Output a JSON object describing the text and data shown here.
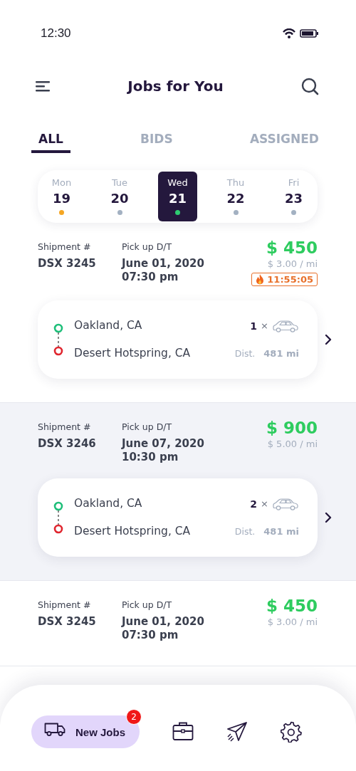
{
  "status_bar": {
    "time": "12:30"
  },
  "header": {
    "title": "Jobs for You"
  },
  "tabs": [
    {
      "label": "ALL",
      "selected": true
    },
    {
      "label": "BIDS",
      "selected": false
    },
    {
      "label": "ASSIGNED",
      "selected": false
    }
  ],
  "dates": [
    {
      "day": "Mon",
      "date": "19",
      "color": "#f5a623",
      "selected": false
    },
    {
      "day": "Tue",
      "date": "20",
      "color": "#a3b1c2",
      "selected": false
    },
    {
      "day": "Wed",
      "date": "21",
      "color": "#2ecc71",
      "selected": true
    },
    {
      "day": "Thu",
      "date": "22",
      "color": "#a3b1c2",
      "selected": false
    },
    {
      "day": "Fri",
      "date": "23",
      "color": "#a3b1c2",
      "selected": false
    }
  ],
  "jobs": [
    {
      "selected": false,
      "shipment_label": "Shipment #",
      "shipment_no": "DSX 3245",
      "pickup_label": "Pick up D/T",
      "pickup_date": "June 01, 2020",
      "pickup_time": "07:30 pm",
      "price": "$ 450",
      "rate": "$ 3.00 / mi",
      "timer": "11:55:05",
      "origin": "Oakland, CA",
      "destination": "Desert Hotspring, CA",
      "vehicle_count": "1",
      "times": "×",
      "dist_label": "Dist.",
      "distance": "481 mi"
    },
    {
      "selected": true,
      "shipment_label": "Shipment #",
      "shipment_no": "DSX 3246",
      "pickup_label": "Pick up D/T",
      "pickup_date": "June 07, 2020",
      "pickup_time": "10:30 pm",
      "price": "$ 900",
      "rate": "$ 5.00 / mi",
      "origin": "Oakland, CA",
      "destination": "Desert Hotspring, CA",
      "vehicle_count": "2",
      "times": "×",
      "dist_label": "Dist.",
      "distance": "481 mi"
    },
    {
      "selected": false,
      "shipment_label": "Shipment #",
      "shipment_no": "DSX 3245",
      "pickup_label": "Pick up D/T",
      "pickup_date": "June 01, 2020",
      "pickup_time": "07:30 pm",
      "price": "$ 450",
      "rate": "$ 3.00 / mi"
    }
  ],
  "bottom_nav": [
    {
      "kind": "truck",
      "label": "New Jobs",
      "badge": "2",
      "selected": true
    },
    {
      "kind": "briefcase",
      "selected": false
    },
    {
      "kind": "send",
      "selected": false
    },
    {
      "kind": "gear",
      "selected": false
    }
  ]
}
